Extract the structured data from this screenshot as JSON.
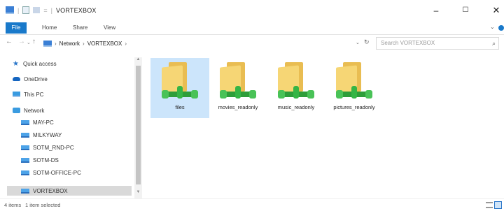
{
  "window": {
    "title": "VORTEXBOX",
    "qa_separator": "|",
    "qa_dropdown": "=",
    "minimize": "–",
    "maximize": "☐",
    "close": "✕"
  },
  "ribbon": {
    "tabs": [
      "File",
      "Home",
      "Share",
      "View"
    ],
    "expand_glyph": "⌄"
  },
  "address_bar": {
    "crumbs": [
      "Network",
      "VORTEXBOX"
    ],
    "separator": "›",
    "search_placeholder": "Search VORTEXBOX",
    "back_glyph": "←",
    "forward_glyph": "→",
    "recent_glyph": "⌄",
    "up_glyph": "↑",
    "refresh_glyph": "↻",
    "search_glyph": "⌕"
  },
  "nav_pane": {
    "items": [
      {
        "label": "Quick access",
        "icon": "star-icon"
      },
      {
        "label": "OneDrive",
        "icon": "cloud-icon"
      },
      {
        "label": "This PC",
        "icon": "computer-icon"
      },
      {
        "label": "Network",
        "icon": "network-icon"
      },
      {
        "label": "MAY-PC",
        "icon": "computer-icon"
      },
      {
        "label": "MILKYWAY",
        "icon": "computer-icon"
      },
      {
        "label": "SOTM_RND-PC",
        "icon": "computer-icon"
      },
      {
        "label": "SOTM-DS",
        "icon": "computer-icon"
      },
      {
        "label": "SOTM-OFFICE-PC",
        "icon": "computer-icon"
      },
      {
        "label": "VORTEXBOX",
        "icon": "computer-icon",
        "selected": true
      }
    ],
    "scroll_up": "▲",
    "scroll_down": "▼"
  },
  "content": {
    "folders": [
      {
        "name": "files",
        "selected": true
      },
      {
        "name": "movies_readonly",
        "selected": false
      },
      {
        "name": "music_readonly",
        "selected": false
      },
      {
        "name": "pictures_readonly",
        "selected": false
      }
    ]
  },
  "status_bar": {
    "item_count": "4 items",
    "selection": "1 item selected"
  },
  "colors": {
    "accent": "#1979ca",
    "selection": "#cce5fb",
    "folder": "#f6d675",
    "network_pipe": "#2e9e3a"
  }
}
